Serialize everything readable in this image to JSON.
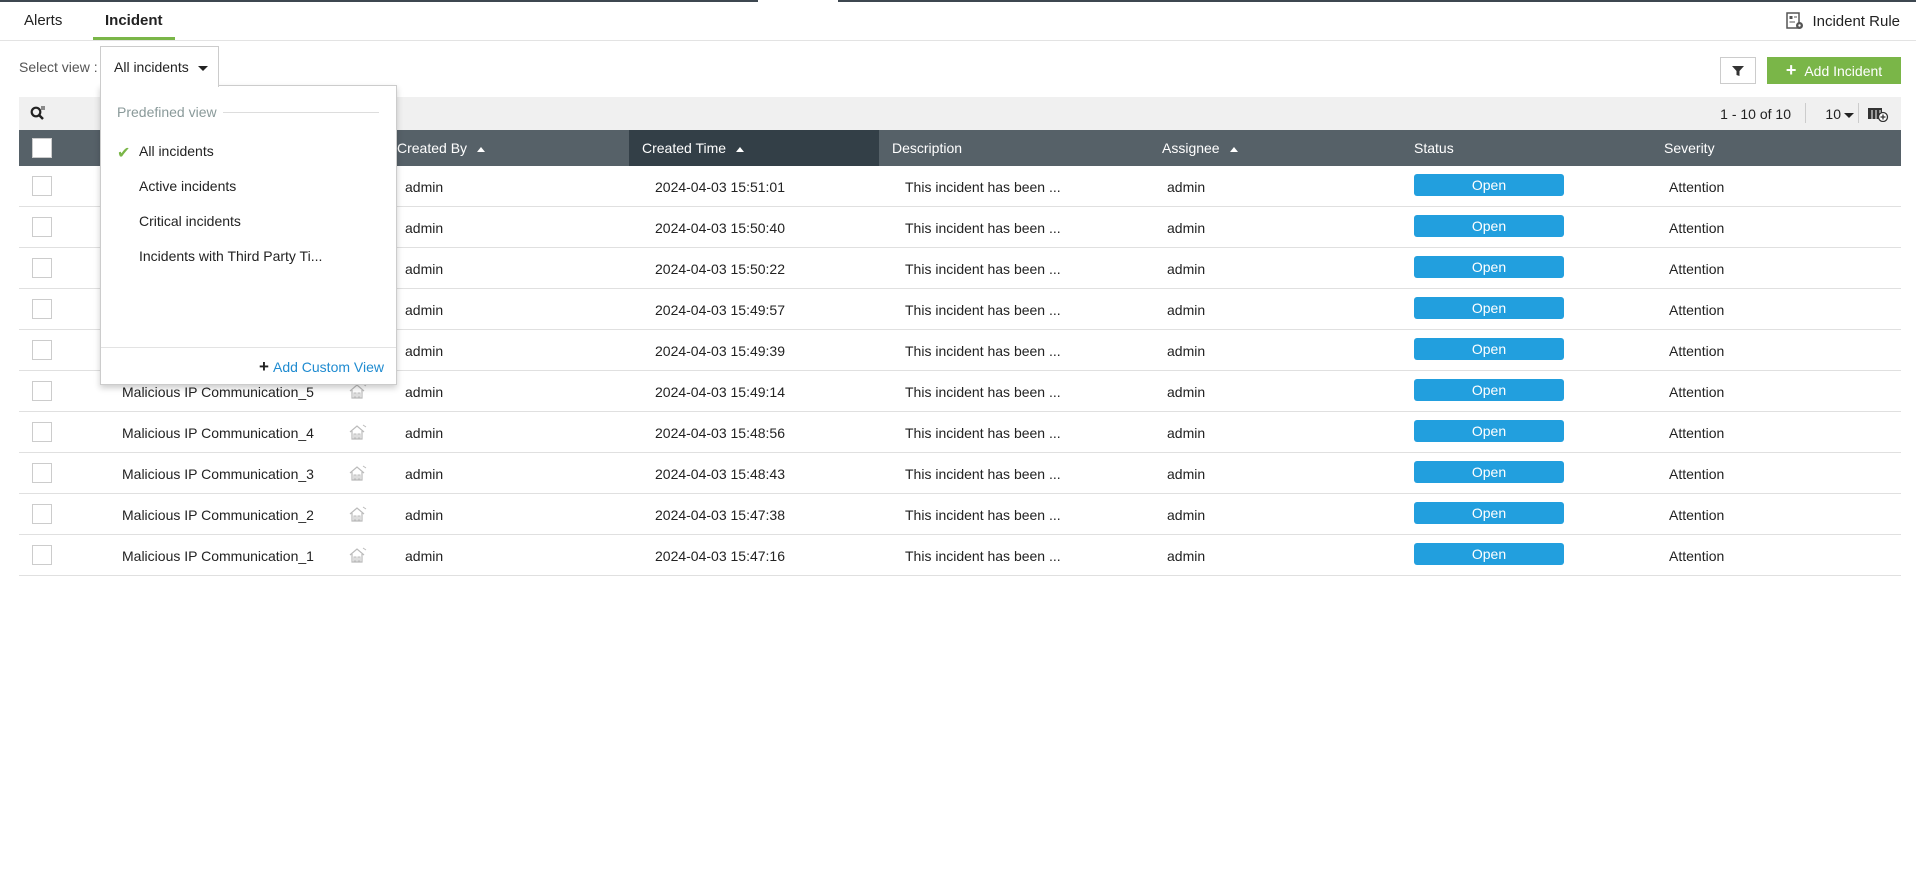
{
  "tabs": [
    {
      "label": "Alerts"
    },
    {
      "label": "Incident",
      "active": true
    }
  ],
  "incident_rule_label": "Incident Rule",
  "select_view_label": "Select view :",
  "view_dropdown": {
    "selected": "All incidents",
    "section_header": "Predefined view",
    "options": [
      "All incidents",
      "Active incidents",
      "Critical incidents",
      "Incidents with Third Party Ti..."
    ],
    "add_custom_view": "Add Custom View"
  },
  "add_incident_label": "Add Incident",
  "pagination": {
    "range": "1 - 10 of 10",
    "per_page": "10"
  },
  "columns": {
    "created_by": "Created By",
    "created_time": "Created Time",
    "description": "Description",
    "assignee": "Assignee",
    "status": "Status",
    "severity": "Severity"
  },
  "colors": {
    "accent": "#7ab648",
    "header": "#566168",
    "status_open": "#229fde",
    "link": "#1f8bd0"
  },
  "rows": [
    {
      "name": "",
      "created_by": "admin",
      "created_time": "2024-04-03 15:51:01",
      "description": "This incident has been ...",
      "assignee": "admin",
      "status": "Open",
      "severity": "Attention"
    },
    {
      "name": "",
      "created_by": "admin",
      "created_time": "2024-04-03 15:50:40",
      "description": "This incident has been ...",
      "assignee": "admin",
      "status": "Open",
      "severity": "Attention"
    },
    {
      "name": "",
      "created_by": "admin",
      "created_time": "2024-04-03 15:50:22",
      "description": "This incident has been ...",
      "assignee": "admin",
      "status": "Open",
      "severity": "Attention"
    },
    {
      "name": "",
      "created_by": "admin",
      "created_time": "2024-04-03 15:49:57",
      "description": "This incident has been ...",
      "assignee": "admin",
      "status": "Open",
      "severity": "Attention"
    },
    {
      "name": "",
      "created_by": "admin",
      "created_time": "2024-04-03 15:49:39",
      "description": "This incident has been ...",
      "assignee": "admin",
      "status": "Open",
      "severity": "Attention"
    },
    {
      "name": "Malicious IP Communication_5",
      "created_by": "admin",
      "created_time": "2024-04-03 15:49:14",
      "description": "This incident has been ...",
      "assignee": "admin",
      "status": "Open",
      "severity": "Attention"
    },
    {
      "name": "Malicious IP Communication_4",
      "created_by": "admin",
      "created_time": "2024-04-03 15:48:56",
      "description": "This incident has been ...",
      "assignee": "admin",
      "status": "Open",
      "severity": "Attention"
    },
    {
      "name": "Malicious IP Communication_3",
      "created_by": "admin",
      "created_time": "2024-04-03 15:48:43",
      "description": "This incident has been ...",
      "assignee": "admin",
      "status": "Open",
      "severity": "Attention"
    },
    {
      "name": "Malicious IP Communication_2",
      "created_by": "admin",
      "created_time": "2024-04-03 15:47:38",
      "description": "This incident has been ...",
      "assignee": "admin",
      "status": "Open",
      "severity": "Attention"
    },
    {
      "name": "Malicious IP Communication_1",
      "created_by": "admin",
      "created_time": "2024-04-03 15:47:16",
      "description": "This incident has been ...",
      "assignee": "admin",
      "status": "Open",
      "severity": "Attention"
    }
  ]
}
